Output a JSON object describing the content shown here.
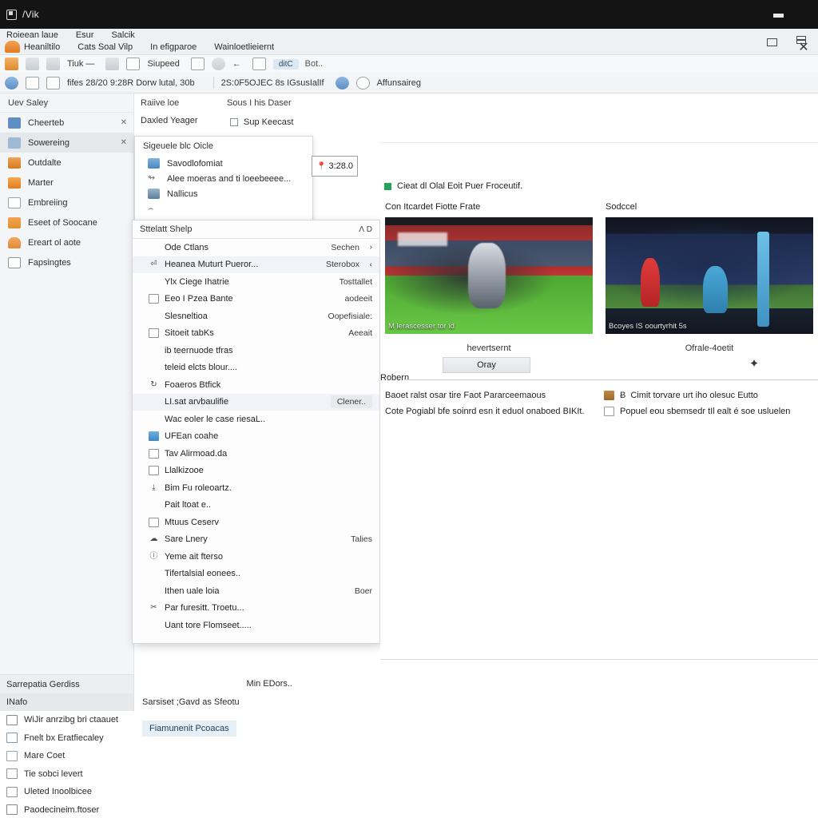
{
  "window": {
    "title": "/Vik",
    "app_icon": "window-icon",
    "controls": {
      "minimize": "minimize-icon",
      "restore": "restore-icon",
      "maximize": "maximize-icon",
      "close": "✕"
    }
  },
  "menubar": {
    "row1": [
      "Roieean laue",
      "Esur",
      "Salcik"
    ],
    "row2": [
      "Heaniltilo",
      "Cats Soal Vilp",
      "In efigparoe",
      "Wainloetlieiernt"
    ]
  },
  "toolbar_primary": {
    "items": [
      {
        "icon": "save-icon",
        "label": ""
      },
      {
        "icon": "copy-icon",
        "label": ""
      },
      {
        "icon": "list-icon",
        "label": "Tiuk —"
      },
      {
        "icon": "flask-icon",
        "label": ""
      },
      {
        "icon": "tool-icon",
        "label": "Siupeed"
      },
      {
        "icon": "brush-icon",
        "label": ""
      },
      {
        "icon": "gear-icon",
        "label": "←"
      },
      {
        "icon": "chevron-down-icon",
        "label": ""
      }
    ],
    "chip": "ditC",
    "chip_suffix": "Bot.."
  },
  "toolbar_secondary": {
    "items": [
      {
        "icon": "clock-icon",
        "label": ""
      },
      {
        "icon": "folder-icon",
        "label": ""
      }
    ],
    "text_left": "fifes 28/20 9:28R Dorw lutal, 30b",
    "text_mid": "2S:0F5OJEC 8s IGsusIalIf",
    "badge_icon": "info-icon",
    "cloud_icon": "cloud-icon",
    "badge_text": "Affunsaireg"
  },
  "sidebar": {
    "header": "Uev Saley",
    "items": [
      {
        "icon": "pen-icon",
        "icon_color": "#5d8fc4",
        "label": "Cheerteb",
        "closable": true,
        "selected": false
      },
      {
        "icon": "cloud-icon",
        "icon_color": "#9fb9d4",
        "label": "Sowereing",
        "closable": true,
        "selected": true
      },
      {
        "icon": "image-icon",
        "icon_color": "#e08a2c",
        "label": "Outdalte",
        "closable": false,
        "selected": false
      },
      {
        "icon": "circle-icon",
        "icon_color": "#e88a2e",
        "label": "Marter",
        "closable": false,
        "selected": false
      },
      {
        "icon": "grid-icon",
        "icon_color": "#b9bec4",
        "label": "Embreiing",
        "closable": false,
        "selected": false
      },
      {
        "icon": "swap-icon",
        "icon_color": "#e0902f",
        "label": "Eseet of Soocane",
        "closable": false,
        "selected": false
      },
      {
        "icon": "dome-icon",
        "icon_color": "#e08a3c",
        "label": "Ereart ol aote",
        "closable": false,
        "selected": false
      },
      {
        "icon": "flag-icon",
        "icon_color": "#8d949c",
        "label": "Fapsingtes",
        "closable": false,
        "selected": false
      }
    ]
  },
  "column2": {
    "header": "Raiive loe",
    "subheader": "Daxled Yeager"
  },
  "column3": {
    "header": "Sous I his Daser",
    "checkbox_label": "Sup Keecast",
    "checked": false
  },
  "signals_panel": {
    "title": "Sigeuele blc Oicle",
    "rows": [
      {
        "icon": "monitor-icon",
        "icon_color": "#5d8fc4",
        "label": "Savodlofomiat"
      },
      {
        "icon": "branch-icon",
        "icon_color": "#8d949c",
        "label": "Alee moeras and ti loeebeeee..."
      },
      {
        "icon": "globe-icon",
        "icon_color": "#6c87a8",
        "label": "Nallicus"
      },
      {
        "icon": "hook-icon",
        "icon_color": "#8d949c",
        "label": ""
      }
    ]
  },
  "context_menu": {
    "header": {
      "title": "Sttelatt Shelp",
      "keys": "Ʌ D"
    },
    "items": [
      {
        "icon": "none",
        "label": "Ode Ctlans",
        "shortcut": "Sechen",
        "arrow": "›",
        "highlighted": false
      },
      {
        "icon": "glyph",
        "glyph": "⏎",
        "label": "Heanea Muturt Pueror...",
        "shortcut": "Sterobox",
        "arrow": "‹",
        "highlighted": true
      },
      {
        "icon": "none",
        "label": "Ylx Ciege Ihatrie",
        "shortcut": "Tosttallet",
        "arrow": "",
        "highlighted": false
      },
      {
        "icon": "box",
        "label": "Eeo I Pzea Bante",
        "shortcut": "aodeeit",
        "arrow": "",
        "highlighted": false
      },
      {
        "icon": "none",
        "label": "Slesneltioa",
        "shortcut": "Oopefisiale:",
        "arrow": "",
        "highlighted": false
      },
      {
        "icon": "box",
        "label": "Sitoeit tabKs",
        "shortcut": "Aeeait",
        "arrow": "",
        "highlighted": false
      },
      {
        "icon": "none",
        "label": "ib teernuode tfras",
        "shortcut": "",
        "arrow": "",
        "highlighted": false
      },
      {
        "icon": "none",
        "label": "teleid elcts blour....",
        "shortcut": "",
        "arrow": "",
        "highlighted": false
      },
      {
        "icon": "glyph",
        "glyph": "↻",
        "label": "Foaeros Btfick",
        "shortcut": "",
        "arrow": "",
        "highlighted": false
      },
      {
        "icon": "none",
        "label": "LI.sat arvbaulifie",
        "shortcut": "Clener..",
        "arrow": "",
        "highlighted": true
      },
      {
        "icon": "none",
        "label": "Wac eoler le case riesaL..",
        "shortcut": "",
        "arrow": "",
        "highlighted": false
      },
      {
        "icon": "fill",
        "label": "UFEan coahe",
        "shortcut": "",
        "arrow": "",
        "highlighted": false
      },
      {
        "icon": "box",
        "label": "Tav Alirmoad.da",
        "shortcut": "",
        "arrow": "",
        "highlighted": false
      },
      {
        "icon": "box",
        "label": "Llalkizooe",
        "shortcut": "",
        "arrow": "",
        "highlighted": false
      },
      {
        "icon": "glyph",
        "glyph": "⤓",
        "label": "Bim Fu roleoartz.",
        "shortcut": "",
        "arrow": "",
        "highlighted": false
      },
      {
        "icon": "none",
        "label": "Pait ltoat e..",
        "shortcut": "",
        "arrow": "",
        "highlighted": false
      },
      {
        "icon": "box",
        "label": "Mtuus Ceserv",
        "shortcut": "",
        "arrow": "",
        "highlighted": false
      },
      {
        "icon": "glyph",
        "glyph": "☁",
        "label": "Sare Lnery",
        "shortcut": "Talies",
        "arrow": "",
        "highlighted": false
      },
      {
        "icon": "glyph",
        "glyph": "ⓘ",
        "label": "Yeme ait fterso",
        "shortcut": "",
        "arrow": "",
        "highlighted": false
      },
      {
        "icon": "none",
        "label": "Tifertalsial eonees..",
        "shortcut": "",
        "arrow": "",
        "highlighted": false
      },
      {
        "icon": "none",
        "label": "Ithen uale loia",
        "shortcut": "Boer",
        "arrow": "",
        "highlighted": false
      },
      {
        "icon": "glyph",
        "glyph": "✂",
        "label": "Par furesitt. Troetu...",
        "shortcut": "",
        "arrow": "",
        "highlighted": false
      },
      {
        "icon": "none",
        "label": "Uant tore Flomseet.....",
        "shortcut": "",
        "arrow": "",
        "highlighted": false
      }
    ]
  },
  "content": {
    "address_input": {
      "value": "3:28.0",
      "pin_icon": "pin-icon"
    },
    "status": {
      "dot_color": "#25a35a",
      "text": "Cieat dl Olal Eoit Puer Froceutif."
    },
    "cards": [
      {
        "caption": "Con Itcardet Fiotte Frate",
        "photo": "rugby-player-stadium-photo",
        "overlay": "M lerascesser tor id",
        "subtitle": "hevertsernt"
      },
      {
        "caption": "Sodccel",
        "photo": "soccer-goalkeeper-stadium-photo",
        "overlay": "Bcoyes IS oourtyrhit 5s",
        "subtitle": "Ofrale-4oetit"
      }
    ],
    "clear_button": "Oray",
    "spark_icon": "sparkle-icon",
    "section_label": "Robern",
    "notes_left": [
      {
        "icon": "none",
        "label": "Baoet ralst osar tire Faot Pararceemaous"
      },
      {
        "icon": "none",
        "label": "Cote Pogiabl bfe soinrd esn it eduol onaboed BIKIt."
      }
    ],
    "notes_right": [
      {
        "icon": "brown",
        "q": "Ƀ",
        "label": "Cimit torvare urt iho olesuc Eutto"
      },
      {
        "icon": "box",
        "q": "",
        "label": "Popuel eou sbemsedr tIl ealt é soe usluelen"
      }
    ]
  },
  "bottom_left": {
    "bar1": "Sarrepatia Gerdiss",
    "bar2": "INafo",
    "items": [
      {
        "icon": "book-icon",
        "icon_color": "#7f8790",
        "label": "WiJir anrzibg bri ctaauet"
      },
      {
        "icon": "photo-icon",
        "icon_color": "#7f98b4",
        "label": "Fnelt bx Eratfiecaley"
      },
      {
        "icon": "box-icon",
        "icon_color": "#9aa1a8",
        "label": "Mare Coet"
      },
      {
        "icon": "shield-icon",
        "icon_color": "#8d949c",
        "label": "Tie sobci levert"
      },
      {
        "icon": "crop-icon",
        "icon_color": "#8d949c",
        "label": "Uleted Inoolbicee"
      },
      {
        "icon": "building-icon",
        "icon_color": "#7f8790",
        "label": "Paodecineim.ftoser"
      }
    ]
  },
  "mid_panel": {
    "row1": "Min EDors..",
    "row2": "Sarsiset ;Gavd as Sfeotu",
    "chip": "Fiamunenit Pcoacas"
  }
}
